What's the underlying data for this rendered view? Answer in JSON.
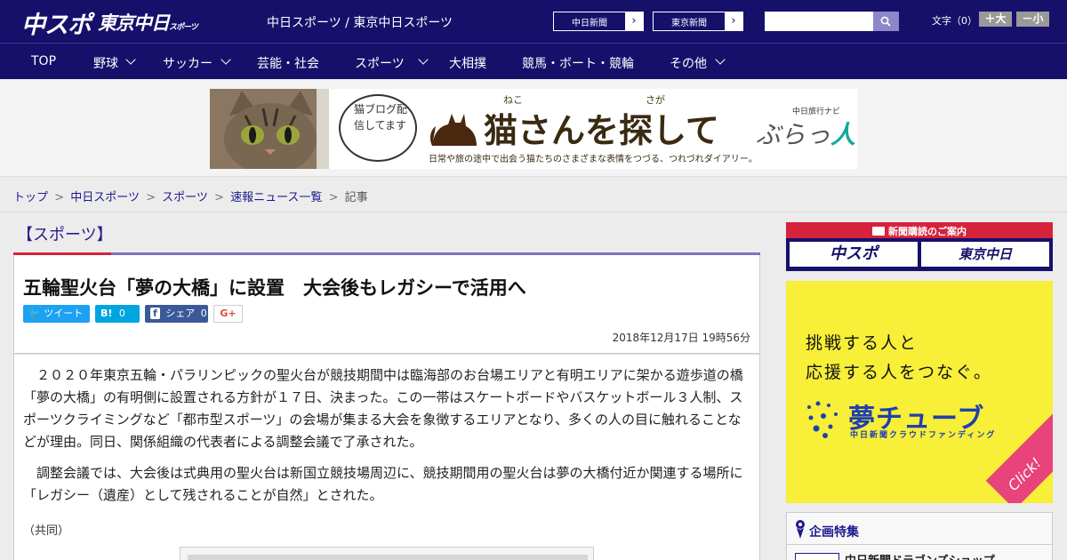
{
  "header": {
    "logo_main": "中スポ",
    "logo_tokyo": "東京中日",
    "logo_tokyo_small": "スポーツ",
    "site_name": "中日スポーツ / 東京中日スポーツ",
    "link_buttons": [
      {
        "label": "中日新聞",
        "arrow": "›"
      },
      {
        "label": "東京新聞",
        "arrow": "›"
      }
    ],
    "search_placeholder": "",
    "font_size_label": "文字（0）",
    "font_larger": "＋大",
    "font_smaller": "－小"
  },
  "nav": {
    "items": [
      {
        "label": "TOP",
        "has_dropdown": false
      },
      {
        "label": "野球",
        "has_dropdown": true
      },
      {
        "label": "サッカー",
        "has_dropdown": true
      },
      {
        "label": "芸能・社会",
        "has_dropdown": false
      },
      {
        "label": "スポーツ",
        "has_dropdown": true
      },
      {
        "label": "大相撲",
        "has_dropdown": false
      },
      {
        "label": "競馬・ボート・競輪",
        "has_dropdown": false
      },
      {
        "label": "その他",
        "has_dropdown": true
      }
    ]
  },
  "banner": {
    "bubble_text": "猫ブログ配信してます",
    "ruby_1": "ねこ",
    "ruby_2": "さが",
    "title": "猫さんを探して",
    "caption": "日常や旅の途中で出会う猫たちのさまざまな表情をつづる、つれづれダイアリー。",
    "brand_small": "中日旅行ナビ",
    "brand_a": "ぶらっ",
    "brand_b": "人"
  },
  "breadcrumb": {
    "items": [
      "トップ",
      "中日スポーツ",
      "スポーツ",
      "速報ニュース一覧"
    ],
    "separator": ">",
    "current": "記事"
  },
  "article": {
    "section": "【スポーツ】",
    "headline": "五輪聖火台「夢の大橋」に設置　大会後もレガシーで活用へ",
    "share": {
      "tweet": "ツイート",
      "hatena_icon": "B!",
      "hatena_count": "0",
      "facebook_icon": "f",
      "facebook_label": "シェア",
      "facebook_count": "0",
      "gplus": "G+"
    },
    "timestamp": "2018年12月17日 19時56分",
    "paragraphs": [
      "２０２０年東京五輪・パラリンピックの聖火台が競技期間中は臨海部のお台場エリアと有明エリアに架かる遊歩道の橋「夢の大橋」の有明側に設置される方針が１７日、決まった。この一帯はスケートボードやバスケットボール３人制、スポーツクライミングなど「都市型スポーツ」の会場が集まる大会を象徴するエリアとなり、多くの人の目に触れることなどが理由。同日、関係組織の代表者による調整会議で了承された。",
      "調整会議では、大会後は式典用の聖火台は新国立競技場周辺に、競技期間用の聖火台は夢の大橋付近か関連する場所に「レガシー（遺産）として残されることが自然」とされた。"
    ],
    "source": "（共同）"
  },
  "sidebar": {
    "subscription_head": "新聞購読のご案内",
    "sub_logo_1": "中スポ",
    "sub_logo_2": "東京中日",
    "ad": {
      "line1": "挑戦する人と",
      "line2": "応援する人をつなぐ。",
      "title": "夢チューブ",
      "subtitle": "中日新聞クラウドファンディング",
      "click": "Click!"
    },
    "feature_title": "企画特集",
    "feature_item": "中日新聞ドラゴンズショップ"
  },
  "colors": {
    "navy": "#17106b",
    "accent_red": "#d6223a",
    "twitter": "#1da1f2",
    "hatena": "#00a4de",
    "facebook": "#3b5998",
    "ad_yellow": "#f7ef38"
  }
}
